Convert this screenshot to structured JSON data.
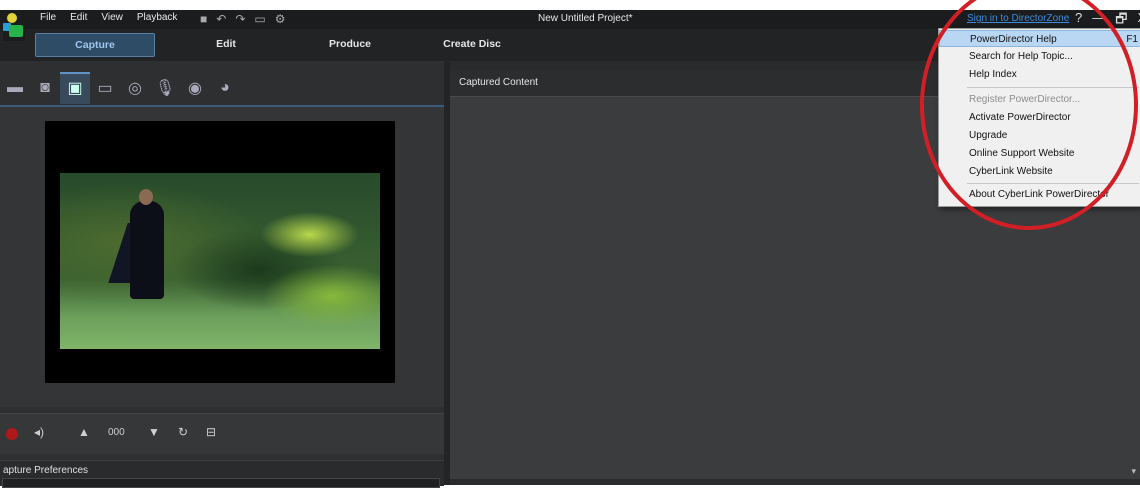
{
  "window": {
    "title": "New Untitled Project*",
    "signin_link": "Sign in to DirectorZone",
    "help_btn": "?",
    "minimize_btn": "—",
    "restore_btn": "🗗",
    "close_btn": "X"
  },
  "menu": {
    "file": "File",
    "edit": "Edit",
    "view": "View",
    "playback": "Playback"
  },
  "modes": {
    "capture": "Capture",
    "edit": "Edit",
    "produce": "Produce",
    "create_disc": "Create Disc"
  },
  "capture": {
    "counter": "000",
    "preferences_label": "apture Preferences"
  },
  "content_panel": {
    "title": "Captured Content"
  },
  "help_menu": {
    "items": [
      {
        "label": "PowerDirector Help",
        "shortcut": "F1"
      },
      {
        "label": "Search for Help Topic..."
      },
      {
        "label": "Help Index"
      },
      {
        "label": "Register PowerDirector..."
      },
      {
        "label": "Activate PowerDirector"
      },
      {
        "label": "Upgrade"
      },
      {
        "label": "Online Support Website"
      },
      {
        "label": "CyberLink Website"
      },
      {
        "label": "About CyberLink PowerDirector"
      }
    ]
  },
  "colors": {
    "accent": "#3b8de0",
    "annotation": "#d21f26",
    "highlight": "#b9d6f2"
  }
}
